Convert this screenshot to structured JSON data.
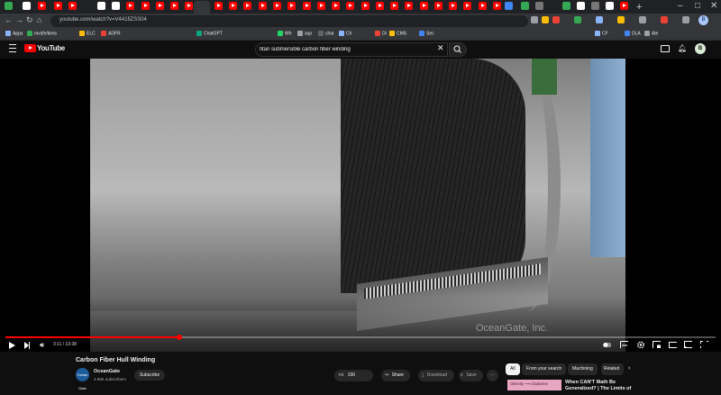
{
  "browser": {
    "url": "youtube.com/watch?v=V441fiZSS04",
    "bookmarks": [
      "Apps",
      "mvsfe/kims",
      "ELC",
      "ADFR",
      "ChatGPT",
      "Wh",
      "asp",
      "char",
      "Ch",
      "Dl",
      "CMS",
      "Sec",
      "CF",
      "DLA",
      "Ale"
    ],
    "profile_initial": "B"
  },
  "youtube": {
    "logo_text": "YouTube",
    "search_query": "titan submersible carbon fiber winding",
    "avatar_initial": "B"
  },
  "player": {
    "time": "3:11 / 13:38",
    "progress_fraction": 0.245,
    "watermark": "OceanGate, Inc."
  },
  "video": {
    "title": "Carbon Fiber Hull Winding",
    "channel": {
      "avatar_text": "Ocean Gate",
      "name": "OceanGate",
      "subscribers": "4.09K subscribers"
    },
    "subscribe_label": "Subscribe",
    "likes": "190",
    "share_label": "Share",
    "download_label": "Download",
    "save_label": "Save",
    "more_label": "···"
  },
  "sidebar": {
    "chips": [
      "All",
      "From your search",
      "Machining",
      "Related"
    ],
    "recommended": {
      "thumb_text": "Obesity ⟶ Diabetes",
      "title_line1": "When CAN'T Math Be",
      "title_line2": "Generalized? | The Limits of"
    }
  }
}
